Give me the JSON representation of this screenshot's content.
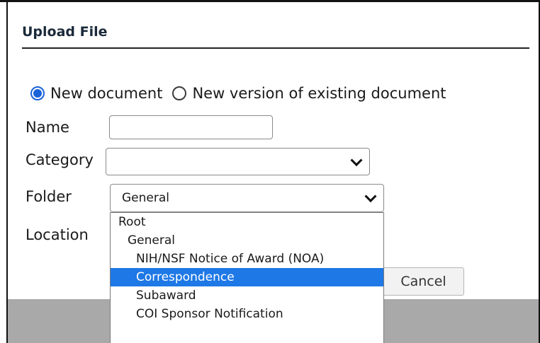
{
  "dialog": {
    "title": "Upload File"
  },
  "upload_mode": {
    "options": [
      {
        "label": "New document",
        "checked": true
      },
      {
        "label": "New version of existing document",
        "checked": false
      }
    ]
  },
  "form": {
    "name_label": "Name",
    "name_value": "",
    "category_label": "Category",
    "category_value": "",
    "folder_label": "Folder",
    "folder_value": "General",
    "location_label": "Location"
  },
  "folder_dropdown": {
    "options": [
      {
        "label": "Root",
        "level": 0,
        "selected": false
      },
      {
        "label": "General",
        "level": 1,
        "selected": false
      },
      {
        "label": "NIH/NSF Notice of Award (NOA)",
        "level": 2,
        "selected": false
      },
      {
        "label": "Correspondence",
        "level": 2,
        "selected": true
      },
      {
        "label": "Subaward",
        "level": 2,
        "selected": false
      },
      {
        "label": "COI Sponsor Notification",
        "level": 2,
        "selected": false
      }
    ]
  },
  "buttons": {
    "cancel_label": "Cancel"
  },
  "colors": {
    "accent": "#1a63d8",
    "selected_option": "#1e78e6",
    "footer_bar": "#a9a9a9"
  }
}
